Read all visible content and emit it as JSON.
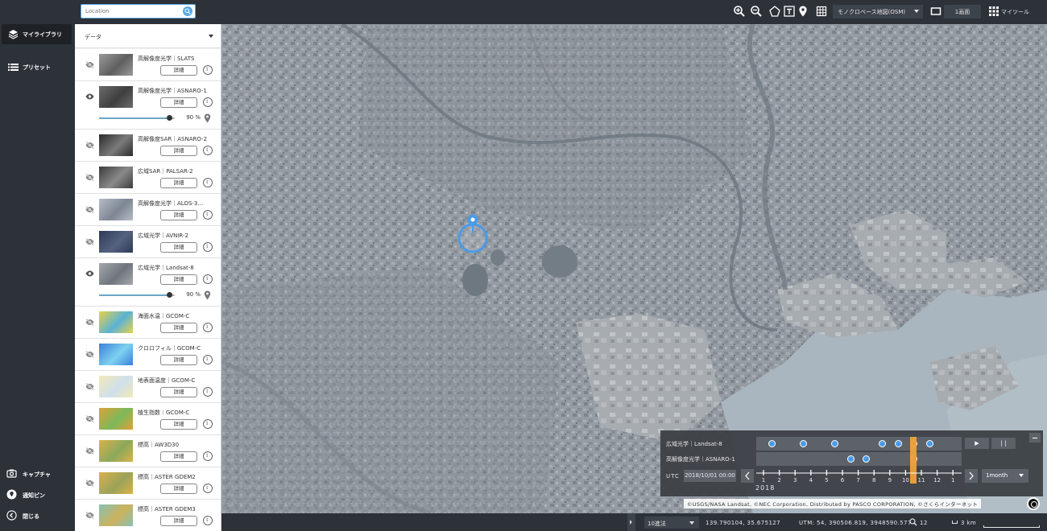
{
  "search": {
    "placeholder": "Location"
  },
  "toolbar": {
    "basemap": "モノクロベース地図(OSM)",
    "layout": "1画面",
    "mytools": "マイツール"
  },
  "nav": {
    "library": "マイライブラリ",
    "preset": "プリセット",
    "capture": "キャプチャ",
    "notify": "通知ピン",
    "close": "閉じる"
  },
  "panel": {
    "title": "データ",
    "detail_label": "詳細",
    "items": [
      {
        "name": "高解像度光学｜SLATS",
        "visible": false
      },
      {
        "name": "高解像度光学｜ASNARO-1",
        "visible": true,
        "opacity": "90",
        "opacity_unit": "%"
      },
      {
        "name": "高解像度SAR｜ASNARO-2",
        "visible": false
      },
      {
        "name": "広域SAR｜PALSAR-2",
        "visible": false
      },
      {
        "name": "高解像度光学｜ALOS-3…",
        "visible": false
      },
      {
        "name": "広域光学｜AVNIR-2",
        "visible": false
      },
      {
        "name": "広域光学｜Landsat-8",
        "visible": true,
        "opacity": "90",
        "opacity_unit": "%"
      },
      {
        "name": "海面水温｜GCOM-C",
        "visible": false
      },
      {
        "name": "クロロフィル｜GCOM-C",
        "visible": false
      },
      {
        "name": "地表面温度｜GCOM-C",
        "visible": false
      },
      {
        "name": "植生指数｜GCOM-C",
        "visible": false
      },
      {
        "name": "標高｜AW3D30",
        "visible": false
      },
      {
        "name": "標高｜ASTER GDEM2",
        "visible": false
      },
      {
        "name": "標高｜ASTER GDEM3",
        "visible": false
      }
    ]
  },
  "timeline": {
    "rows": [
      {
        "name": "広域光学｜Landsat-8"
      },
      {
        "name": "高解像度光学｜ASNARO-1"
      }
    ],
    "play": "▶",
    "pause": "| |",
    "utc_label": "UTC",
    "datetime": "2018/10/01 00:00",
    "months": [
      "1",
      "2",
      "3",
      "4",
      "5",
      "6",
      "7",
      "8",
      "9",
      "10",
      "11",
      "12",
      "1"
    ],
    "year": "2018",
    "range": "1month"
  },
  "attribution": "©USGS/NASA Landsat, ©NEC Corporation, Distributed by PASCO CORPORATION, ©さくらインターネット",
  "status": {
    "coord_format": "10進法",
    "latlon": "139.790104, 35.675127",
    "utm": "UTM: 54, 390506.819, 3948590.577",
    "zoom": "12",
    "scale": "3 km"
  },
  "colors": {
    "chrome": "#2d3239",
    "accent": "#4b9be6",
    "highlight": "#f0a23a",
    "marker_selected": "#e02b2b"
  }
}
